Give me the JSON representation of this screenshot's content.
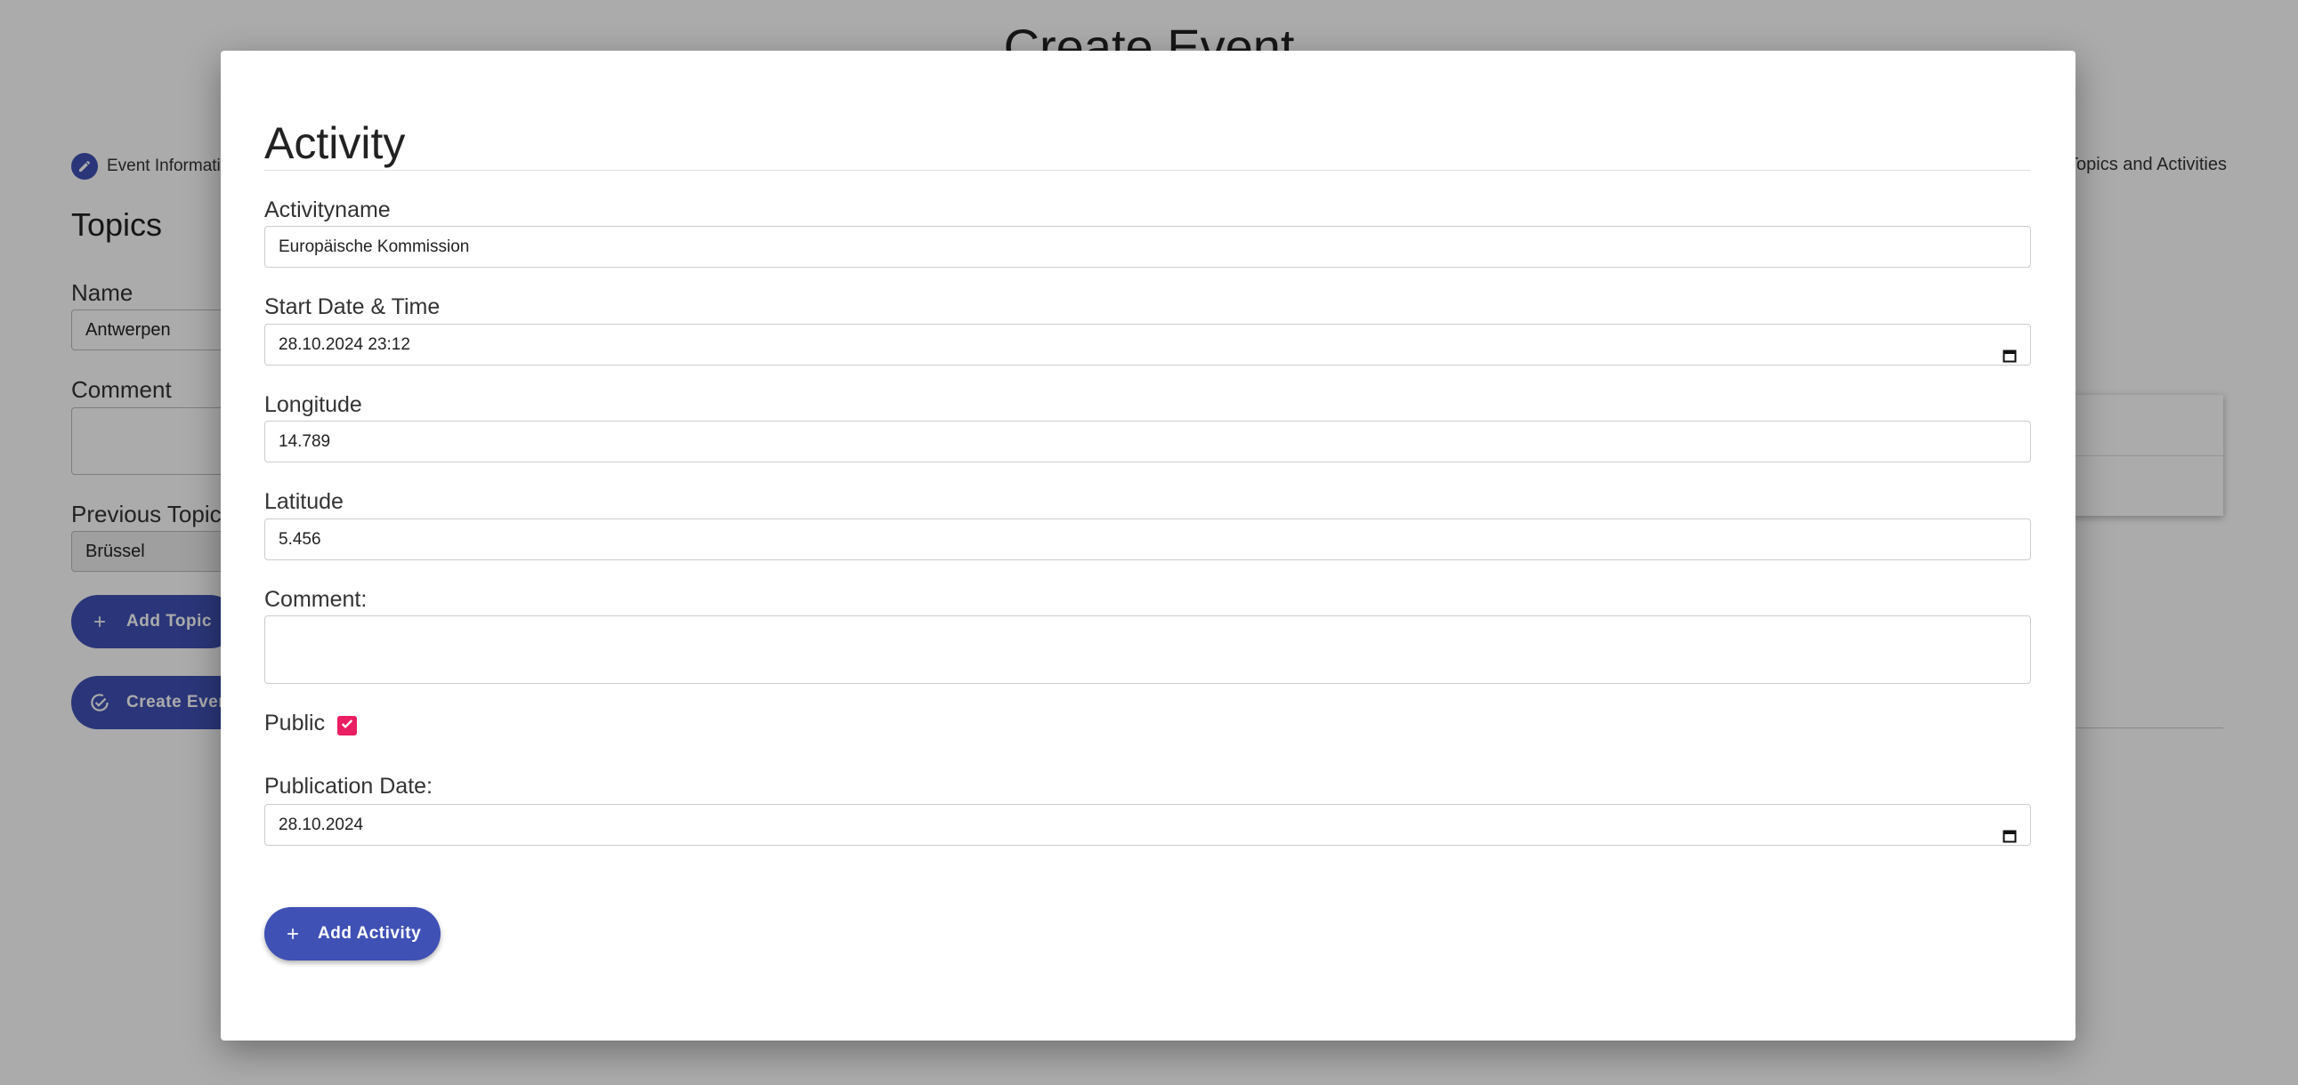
{
  "background": {
    "page_title": "Create Event",
    "stepper": {
      "step1_label": "Event Information",
      "step3_label": "Topics and Activities"
    },
    "topics_heading": "Topics",
    "name_label": "Name",
    "name_value": "Antwerpen",
    "comment_label": "Comment",
    "previous_topic_label": "Previous Topic",
    "previous_topic_value": "Brüssel",
    "add_topic_label": "Add Topic",
    "create_event_label": "Create Event"
  },
  "modal": {
    "title": "Activity",
    "activityname_label": "Activityname",
    "activityname_value": "Europäische Kommission",
    "start_label": "Start Date & Time",
    "start_value": "28.10.2024 23:12",
    "longitude_label": "Longitude",
    "longitude_value": "14.789",
    "latitude_label": "Latitude",
    "latitude_value": "5.456",
    "comment_label": "Comment:",
    "comment_value": "",
    "public_label": "Public",
    "public_checked": true,
    "publication_label": "Publication Date:",
    "publication_value": "28.10.2024",
    "add_activity_label": "Add Activity"
  },
  "colors": {
    "primary": "#3f51b5",
    "checkbox_accent": "#e91e63",
    "overlay": "rgba(0,0,0,0.33)"
  },
  "icons": [
    "pencil-icon",
    "plus-icon",
    "check-circle-plus-icon",
    "calendar-icon",
    "check-icon"
  ]
}
